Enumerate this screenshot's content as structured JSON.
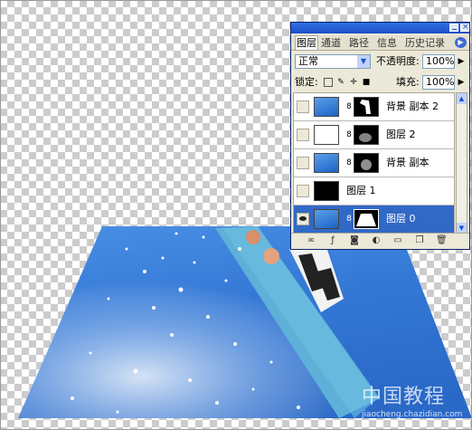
{
  "palette": {
    "tabs": [
      "图层",
      "通道",
      "路径",
      "信息",
      "历史记录"
    ],
    "blend_mode": "正常",
    "opacity_label": "不透明度:",
    "opacity_value": "100%",
    "lock_label": "锁定:",
    "fill_label": "填充:",
    "fill_value": "100%",
    "layers": [
      {
        "name": "背景 副本 2",
        "thumb": "photo",
        "mask": "figure",
        "visible": false,
        "selected": false
      },
      {
        "name": "图层 2",
        "thumb": "white",
        "mask": "splash",
        "visible": false,
        "selected": false
      },
      {
        "name": "背景 副本",
        "thumb": "photo",
        "mask": "splash",
        "visible": false,
        "selected": false
      },
      {
        "name": "图层 1",
        "thumb": "black",
        "mask": null,
        "visible": false,
        "selected": false
      },
      {
        "name": "图层 0",
        "thumb": "photo",
        "mask": "shape",
        "visible": true,
        "selected": true
      }
    ]
  },
  "watermark": {
    "main": "中国教程",
    "sub": "jiaocheng.chazidian.com"
  },
  "colors": {
    "selection": "#3169c6",
    "sky": "#3a7fd8",
    "board": "#5fb0d8"
  }
}
